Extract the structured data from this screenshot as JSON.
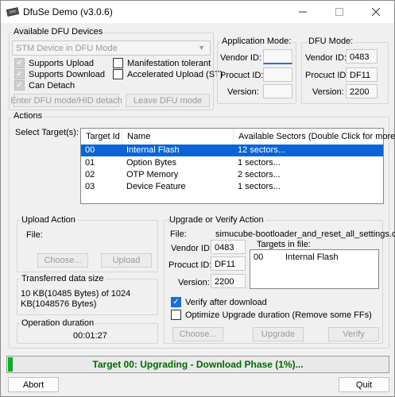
{
  "window": {
    "title": "DfuSe Demo (v3.0.6)"
  },
  "available": {
    "group_title": "Available DFU Devices",
    "device_combo": "STM Device in DFU Mode",
    "cb_upload": "Supports Upload",
    "cb_download": "Supports Download",
    "cb_detach": "Can Detach",
    "cb_manifest": "Manifestation tolerant",
    "cb_accel": "Accelerated Upload (ST)",
    "btn_enter": "Enter DFU mode/HID detach",
    "btn_leave": "Leave DFU mode"
  },
  "app_mode": {
    "title": "Application Mode:",
    "vendor_label": "Vendor ID:",
    "product_label": "Procuct ID:",
    "version_label": "Version:",
    "vendor": "",
    "product": "",
    "version": ""
  },
  "dfu_mode": {
    "title": "DFU Mode:",
    "vendor_label": "Vendor ID:",
    "product_label": "Procuct ID:",
    "version_label": "Version:",
    "vendor": "0483",
    "product": "DF11",
    "version": "2200"
  },
  "actions": {
    "group_title": "Actions",
    "select_label": "Select Target(s):",
    "headers": [
      "Target Id",
      "Name",
      "Available Sectors (Double Click for more)"
    ],
    "rows": [
      [
        "00",
        "Internal Flash",
        "12 sectors..."
      ],
      [
        "01",
        "Option Bytes",
        "1 sectors..."
      ],
      [
        "02",
        "OTP Memory",
        "2 sectors..."
      ],
      [
        "03",
        "Device Feature",
        "1 sectors..."
      ]
    ]
  },
  "upload": {
    "group_title": "Upload Action",
    "file_label": "File:",
    "btn_choose": "Choose...",
    "btn_upload": "Upload"
  },
  "transferred": {
    "group_title": "Transferred data size",
    "text": "10 KB(10485 Bytes) of 1024 KB(1048576 Bytes)"
  },
  "duration": {
    "group_title": "Operation duration",
    "value": "00:01:27"
  },
  "upgrade": {
    "group_title": "Upgrade or Verify Action",
    "file_label": "File:",
    "file_name": "simucube-bootloader_and_reset_all_settings.dfu",
    "vendor_label": "Vendor ID:",
    "product_label": "Procuct ID:",
    "version_label": "Version:",
    "vendor": "0483",
    "product": "DF11",
    "version": "2200",
    "targets_label": "Targets in file:",
    "target_id": "00",
    "target_name": "Internal Flash",
    "cb_verify": "Verify after download",
    "cb_optimize": "Optimize Upgrade duration (Remove some FFs)",
    "btn_choose": "Choose...",
    "btn_upgrade": "Upgrade",
    "btn_verify": "Verify"
  },
  "status": {
    "text": "Target 00: Upgrading - Download Phase (1%)...",
    "progress": 0.01
  },
  "footer": {
    "btn_abort": "Abort",
    "btn_quit": "Quit"
  }
}
